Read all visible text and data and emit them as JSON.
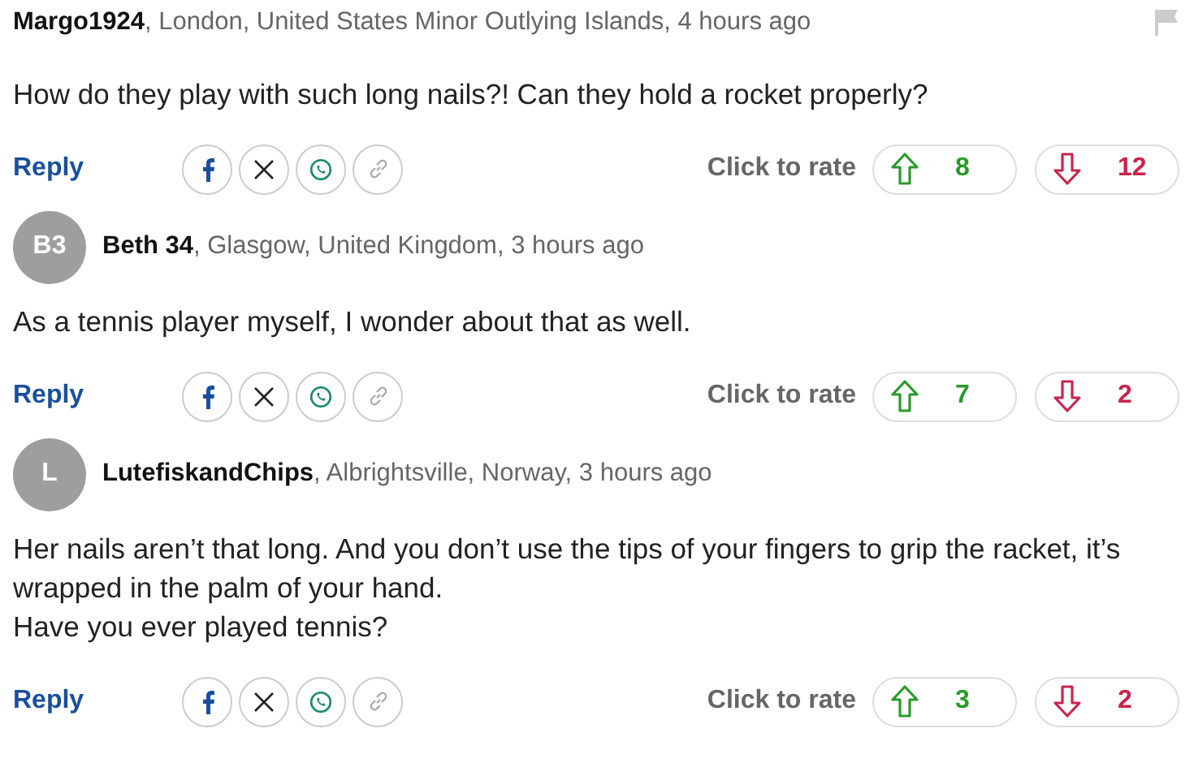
{
  "comments": [
    {
      "author": "Margo1924",
      "meta": ", London, United States Minor Outlying Islands, 4 hours ago",
      "report_flag": true,
      "body": [
        "How do they play with such long nails?! Can they hold a rocket properly?"
      ],
      "reply": "Reply",
      "rate_label": "Click to rate",
      "up": "8",
      "down": "12"
    },
    {
      "avatar": "B3",
      "author": "Beth 34",
      "meta": ", Glasgow, United Kingdom, 3 hours ago",
      "report_flag": false,
      "body": [
        "As a tennis player myself, I wonder about that as well."
      ],
      "reply": "Reply",
      "rate_label": "Click to rate",
      "up": "7",
      "down": "2"
    },
    {
      "avatar": "L",
      "author": "LutefiskandChips",
      "meta": ", Albrightsville, Norway, 3 hours ago",
      "report_flag": false,
      "body": [
        "Her nails aren’t that long. And you don’t use the tips of your fingers to grip the racket, it’s wrapped in the palm of your hand.",
        "Have you ever played tennis?"
      ],
      "reply": "Reply",
      "rate_label": "Click to rate",
      "up": "3",
      "down": "2"
    }
  ]
}
